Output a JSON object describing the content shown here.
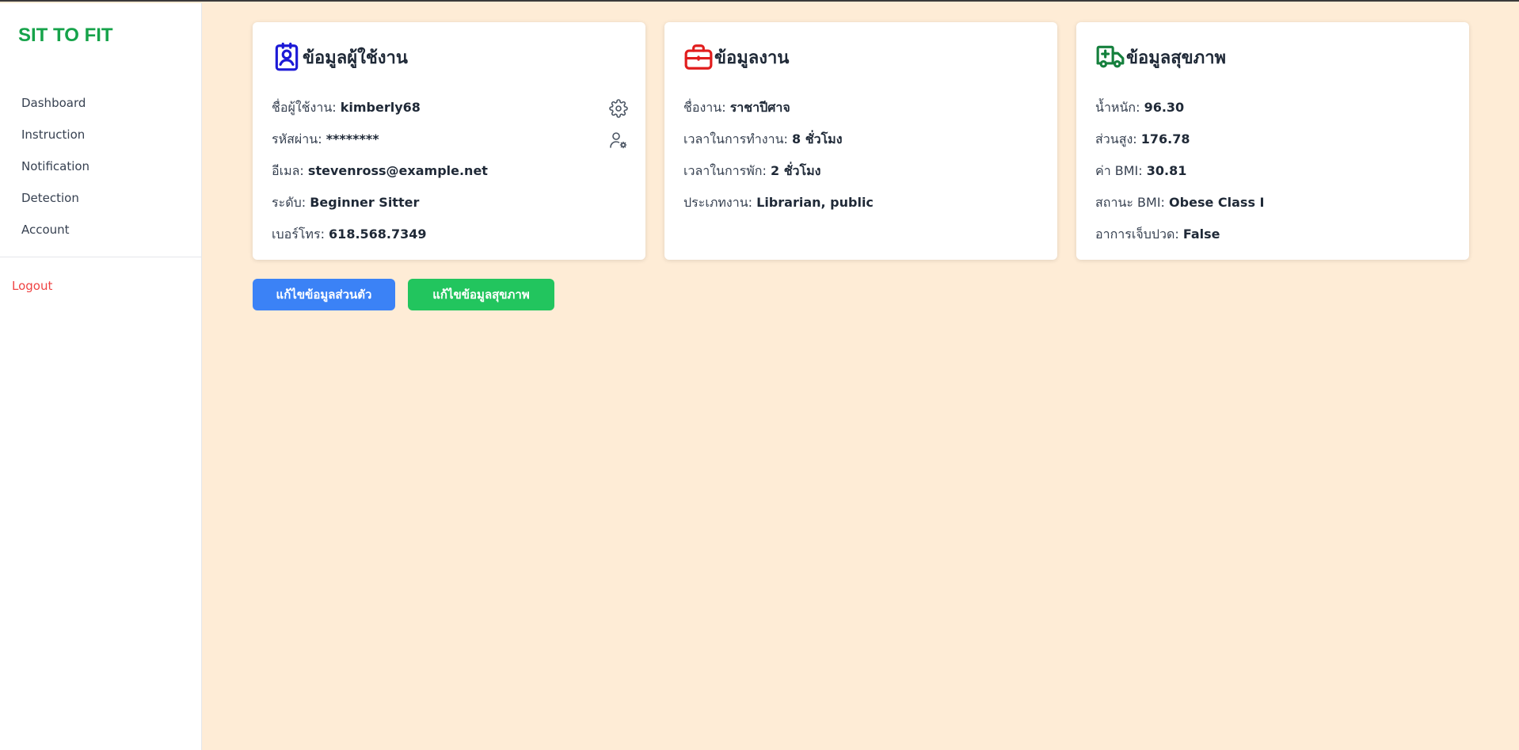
{
  "sidebar": {
    "brand": "SIT TO FIT",
    "items": [
      {
        "label": "Dashboard"
      },
      {
        "label": "Instruction"
      },
      {
        "label": "Notification"
      },
      {
        "label": "Detection"
      },
      {
        "label": "Account"
      }
    ],
    "logout": "Logout"
  },
  "cards": {
    "user": {
      "title": "ข้อมูลผู้ใช้งาน",
      "icon": "user-badge-icon",
      "rows": [
        {
          "label": "ชื่อผู้ใช้งาน:",
          "value": "kimberly68"
        },
        {
          "label": "รหัสผ่าน:",
          "value": "********"
        },
        {
          "label": "อีเมล:",
          "value": "stevenross@example.net"
        },
        {
          "label": "ระดับ:",
          "value": "Beginner Sitter"
        },
        {
          "label": "เบอร์โทร:",
          "value": "618.568.7349"
        }
      ]
    },
    "work": {
      "title": "ข้อมูลงาน",
      "icon": "briefcase-icon",
      "rows": [
        {
          "label": "ชื่องาน:",
          "value": "ราชาปีศาจ"
        },
        {
          "label": "เวลาในการทำงาน:",
          "value": "8 ชั่วโมง"
        },
        {
          "label": "เวลาในการพัก:",
          "value": "2 ชั่วโมง"
        },
        {
          "label": "ประเภทงาน:",
          "value": "Librarian, public"
        }
      ]
    },
    "health": {
      "title": "ข้อมูลสุขภาพ",
      "icon": "ambulance-icon",
      "rows": [
        {
          "label": "น้ำหนัก:",
          "value": "96.30"
        },
        {
          "label": "ส่วนสูง:",
          "value": "176.78"
        },
        {
          "label": "ค่า BMI:",
          "value": "30.81"
        },
        {
          "label": "สถานะ BMI:",
          "value": "Obese Class I"
        },
        {
          "label": "อาการเจ็บปวด:",
          "value": "False"
        }
      ]
    }
  },
  "buttons": {
    "edit_personal": "แก้ไขข้อมูลส่วนตัว",
    "edit_health": "แก้ไขข้อมูลสุขภาพ"
  },
  "colors": {
    "background": "#feecd6",
    "brand": "#16a34a",
    "logout": "#ef4444",
    "user_icon": "#1d1ad6",
    "work_icon": "#e11d1d",
    "health_icon": "#15803d",
    "btn_blue": "#3b82f6",
    "btn_green": "#22c55e"
  }
}
